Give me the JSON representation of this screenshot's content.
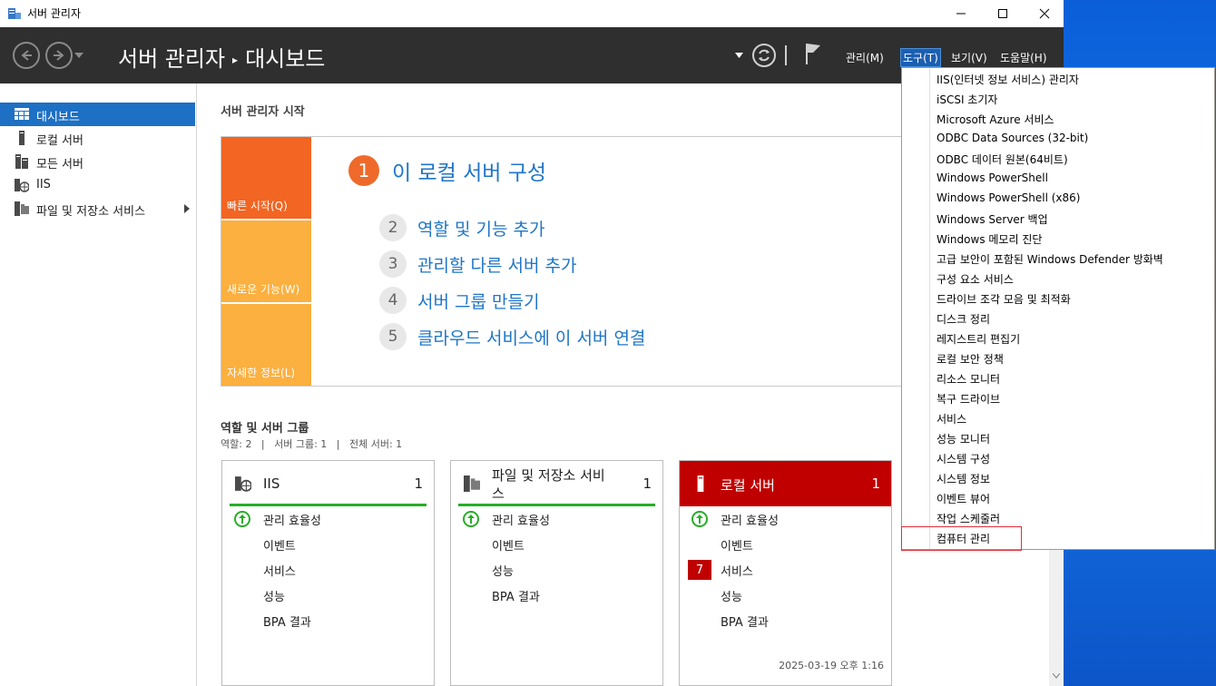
{
  "window": {
    "title": "서버 관리자",
    "controls": [
      "minimize-icon",
      "maximize-icon",
      "close-icon"
    ]
  },
  "header": {
    "breadcrumb": [
      "서버 관리자",
      "대시보드"
    ],
    "menu": [
      {
        "label": "관리(M)"
      },
      {
        "label": "도구(T)",
        "active": true
      },
      {
        "label": "보기(V)"
      },
      {
        "label": "도움말(H)"
      }
    ]
  },
  "sidebar": {
    "items": [
      {
        "label": "대시보드",
        "icon": "dashboard-icon",
        "selected": true
      },
      {
        "label": "로컬 서버",
        "icon": "server-icon"
      },
      {
        "label": "모든 서버",
        "icon": "servers-icon"
      },
      {
        "label": "IIS",
        "icon": "iis-icon"
      },
      {
        "label": "파일 및 저장소 서비스",
        "icon": "storage-icon",
        "expandable": true
      }
    ]
  },
  "welcome": {
    "title": "서버 관리자 시작",
    "tiles": [
      "빠른 시작(Q)",
      "새로운 기능(W)",
      "자세한 정보(L)"
    ],
    "steps": [
      {
        "num": "1",
        "label": "이 로컬 서버 구성"
      },
      {
        "num": "2",
        "label": "역할 및 기능 추가"
      },
      {
        "num": "3",
        "label": "관리할 다른 서버 추가"
      },
      {
        "num": "4",
        "label": "서버 그룹 만들기"
      },
      {
        "num": "5",
        "label": "클라우드 서비스에 이 서버 연결"
      }
    ]
  },
  "roles": {
    "title": "역할 및 서버 그룹",
    "subtitle": "역할: 2   |   서버 그룹: 1   |   전체 서버: 1",
    "cards": [
      {
        "title": "IIS",
        "count": "1",
        "rows": [
          "관리 효율성",
          "이벤트",
          "서비스",
          "성능",
          "BPA 결과"
        ]
      },
      {
        "title": "파일 및 저장소 서비\n스",
        "count": "1",
        "rows": [
          "관리 효율성",
          "이벤트",
          "성능",
          "BPA 결과"
        ]
      },
      {
        "title": "로컬 서버",
        "count": "1",
        "rows": [
          "관리 효율성",
          "이벤트",
          "서비스",
          "성능",
          "BPA 결과"
        ],
        "services_badge": "7",
        "timestamp": "2025-03-19 오후 1:16"
      }
    ]
  },
  "tools_menu": {
    "items": [
      "IIS(인터넷 정보 서비스) 관리자",
      "iSCSI 초기자",
      "Microsoft Azure 서비스",
      "ODBC Data Sources (32-bit)",
      "ODBC 데이터 원본(64비트)",
      "Windows PowerShell",
      "Windows PowerShell (x86)",
      "Windows Server 백업",
      "Windows 메모리 진단",
      "고급 보안이 포함된 Windows Defender 방화벽",
      "구성 요소 서비스",
      "드라이브 조각 모음 및 최적화",
      "디스크 정리",
      "레지스트리 편집기",
      "로컬 보안 정책",
      "리소스 모니터",
      "복구 드라이브",
      "서비스",
      "성능 모니터",
      "시스템 구성",
      "시스템 정보",
      "이벤트 뷰어",
      "작업 스케줄러",
      "컴퓨터 관리"
    ],
    "highlighted": "컴퓨터 관리"
  },
  "colors": {
    "header_bg": "#2f2f2f",
    "accent": "#1d70c4",
    "quick_start": "#f26522",
    "tile_light": "#fbb040",
    "ok_green": "#27ae27",
    "alert_red": "#c00000"
  }
}
